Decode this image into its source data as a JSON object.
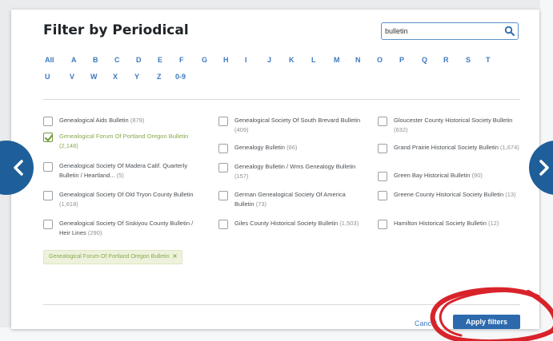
{
  "modal": {
    "title": "Filter by Periodical",
    "search": {
      "value": "bulletin",
      "icon": "search-icon"
    },
    "alphabet": {
      "row1": [
        "All",
        "A",
        "B",
        "C",
        "D",
        "E",
        "F",
        "G",
        "H",
        "I",
        "J",
        "K",
        "L",
        "M",
        "N",
        "O",
        "P",
        "Q",
        "R",
        "S",
        "T"
      ],
      "row2": [
        "U",
        "V",
        "W",
        "X",
        "Y",
        "Z",
        "0-9"
      ]
    },
    "items": [
      {
        "label": "Genealogical Aids Bulletin",
        "count": "(879)",
        "checked": false
      },
      {
        "label": "Genealogical Forum Of Portland Oregon Bulletin",
        "count": "(2,148)",
        "checked": true
      },
      {
        "label": "Genealogical Society Of Madera Calif. Quarterly Bulletin / Heartland...",
        "count": "(5)",
        "checked": false
      },
      {
        "label": "Genealogical Society Of Old Tryon County Bulletin",
        "count": "(1,618)",
        "checked": false
      },
      {
        "label": "Genealogical Society Of Siskiyou County Bulletin / Heir Lines",
        "count": "(290)",
        "checked": false
      },
      {
        "label": "Genealogical Society Of South Brevard Bulletin",
        "count": "(409)",
        "checked": false
      },
      {
        "label": "Genealogy Bulletin",
        "count": "(66)",
        "checked": false
      },
      {
        "label": "Genealogy Bulletin / Wms Genealogy Bulletin",
        "count": "(157)",
        "checked": false
      },
      {
        "label": "German Genealogical Society Of America Bulletin",
        "count": "(73)",
        "checked": false
      },
      {
        "label": "Giles County Historical Society Bulletin",
        "count": "(1,503)",
        "checked": false
      },
      {
        "label": "Gloucester County Historical Society Bulletin",
        "count": "(632)",
        "checked": false
      },
      {
        "label": "Grand Prairie Historical Society Bulletin",
        "count": "(1,674)",
        "checked": false
      },
      {
        "label": "Green Bay Historical Bulletin",
        "count": "(90)",
        "checked": false
      },
      {
        "label": "Greene County Historical Society Bulletin",
        "count": "(13)",
        "checked": false
      },
      {
        "label": "Hamilton Historical Society Bulletin",
        "count": "(12)",
        "checked": false
      }
    ],
    "selected_tag": "Genealogical Forum Of Portland Oregon Bulletin",
    "tag_remove": "✕",
    "cancel_label": "Cancel",
    "apply_label": "Apply filters"
  },
  "nav": {
    "prev_icon": "chevron-left-icon",
    "next_icon": "chevron-right-icon"
  },
  "colors": {
    "accent": "#2c6aad",
    "link": "#3d79bf",
    "selected_text": "#8aa84f",
    "checkmark": "#6e9b3c",
    "nav_circle": "#1f5f99",
    "annotation": "#d8232a"
  }
}
